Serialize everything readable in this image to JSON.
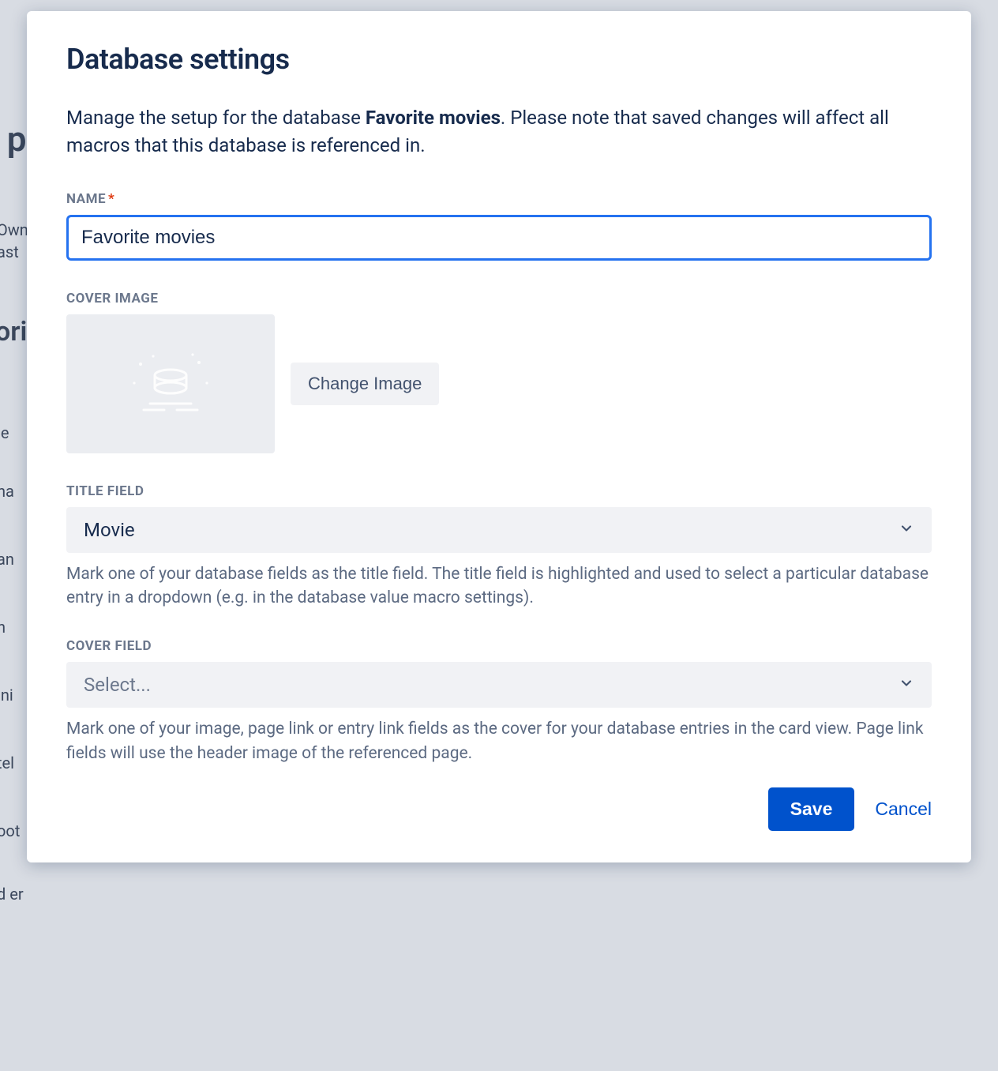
{
  "background": {
    "frag1": "Own",
    "frag2": "ast",
    "frag3": "ori",
    "frag4": "ie",
    "frag5": "ha",
    "frag6": "an",
    "frag7": "n",
    "frag8": "ini",
    "frag9": "tel",
    "frag10": "oot",
    "frag11": "d er",
    "frag12": "y p"
  },
  "modal": {
    "title": "Database settings",
    "desc_prefix": "Manage the setup for the database ",
    "desc_db_name": "Favorite movies",
    "desc_suffix": ". Please note that saved changes will affect all macros that this database is referenced in.",
    "name": {
      "label": "NAME",
      "required_mark": "*",
      "value": "Favorite movies"
    },
    "cover_image": {
      "label": "COVER IMAGE",
      "change_button": "Change Image"
    },
    "title_field": {
      "label": "TITLE FIELD",
      "value": "Movie",
      "helper": "Mark one of your database fields as the title field. The title field is highlighted and used to select a particular database entry in a dropdown (e.g. in the database value macro settings)."
    },
    "cover_field": {
      "label": "COVER FIELD",
      "placeholder": "Select...",
      "helper": "Mark one of your image, page link or entry link fields as the cover for your database entries in the card view. Page link fields will use the header image of the referenced page."
    },
    "footer": {
      "save": "Save",
      "cancel": "Cancel"
    }
  }
}
